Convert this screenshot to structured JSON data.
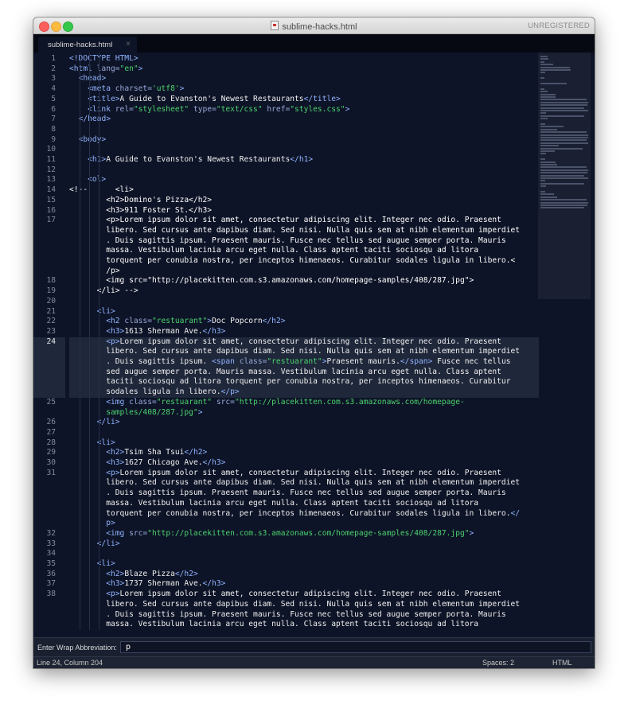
{
  "window": {
    "title": "sublime-hacks.html",
    "unregistered": "UNREGISTERED"
  },
  "tab": {
    "label": "sublime-hacks.html",
    "close": "×"
  },
  "editor": {
    "active_line": 24,
    "visual_lines": [
      {
        "n": "1",
        "tokens": [
          [
            "tag",
            "<!DOCTYPE HTML>"
          ]
        ]
      },
      {
        "n": "2",
        "tokens": [
          [
            "tag",
            "<html "
          ],
          [
            "attr",
            "lang="
          ],
          [
            "str",
            "\"en\""
          ],
          [
            "tag",
            ">"
          ]
        ]
      },
      {
        "n": "3",
        "tokens": [
          [
            "txt",
            "  "
          ],
          [
            "tag",
            "<head>"
          ]
        ]
      },
      {
        "n": "4",
        "tokens": [
          [
            "txt",
            "    "
          ],
          [
            "tag",
            "<meta "
          ],
          [
            "attr",
            "charset="
          ],
          [
            "str",
            "'utf8'"
          ],
          [
            "tag",
            ">"
          ]
        ]
      },
      {
        "n": "5",
        "tokens": [
          [
            "txt",
            "    "
          ],
          [
            "tag",
            "<title>"
          ],
          [
            "txt",
            "A Guide to Evanston's Newest Restaurants"
          ],
          [
            "tag",
            "</title>"
          ]
        ]
      },
      {
        "n": "6",
        "tokens": [
          [
            "txt",
            "    "
          ],
          [
            "tag",
            "<link "
          ],
          [
            "attr",
            "rel="
          ],
          [
            "str",
            "\"stylesheet\""
          ],
          [
            "attr",
            " type="
          ],
          [
            "str",
            "\"text/css\""
          ],
          [
            "attr",
            " href="
          ],
          [
            "str",
            "\"styles.css\""
          ],
          [
            "tag",
            ">"
          ]
        ]
      },
      {
        "n": "7",
        "tokens": [
          [
            "txt",
            "  "
          ],
          [
            "tag",
            "</head>"
          ]
        ]
      },
      {
        "n": "8",
        "tokens": []
      },
      {
        "n": "9",
        "tokens": [
          [
            "txt",
            "  "
          ],
          [
            "tag",
            "<body>"
          ]
        ]
      },
      {
        "n": "10",
        "tokens": []
      },
      {
        "n": "11",
        "tokens": [
          [
            "txt",
            "    "
          ],
          [
            "tag",
            "<h1>"
          ],
          [
            "txt",
            "A Guide to Evanston's Newest Restaurants"
          ],
          [
            "tag",
            "</h1>"
          ]
        ]
      },
      {
        "n": "12",
        "tokens": []
      },
      {
        "n": "13",
        "tokens": [
          [
            "txt",
            "    "
          ],
          [
            "tag",
            "<ol>"
          ]
        ]
      },
      {
        "n": "14",
        "tokens": [
          [
            "cmt",
            "<!--      <li>"
          ]
        ]
      },
      {
        "n": "15",
        "tokens": [
          [
            "cmt",
            "        <h2>Domino's Pizza</h2>"
          ]
        ]
      },
      {
        "n": "16",
        "tokens": [
          [
            "cmt",
            "        <h3>911 Foster St.</h3>"
          ]
        ]
      },
      {
        "n": "17",
        "tokens": [
          [
            "cmt",
            "        <p>Lorem ipsum dolor sit amet, consectetur adipiscing elit. Integer nec odio. Praesent"
          ]
        ]
      },
      {
        "n": "",
        "tokens": [
          [
            "cmt",
            "        libero. Sed cursus ante dapibus diam. Sed nisi. Nulla quis sem at nibh elementum imperdiet"
          ]
        ]
      },
      {
        "n": "",
        "tokens": [
          [
            "cmt",
            "        . Duis sagittis ipsum. Praesent mauris. Fusce nec tellus sed augue semper porta. Mauris"
          ]
        ]
      },
      {
        "n": "",
        "tokens": [
          [
            "cmt",
            "        massa. Vestibulum lacinia arcu eget nulla. Class aptent taciti sociosqu ad litora"
          ]
        ]
      },
      {
        "n": "",
        "tokens": [
          [
            "cmt",
            "        torquent per conubia nostra, per inceptos himenaeos. Curabitur sodales ligula in libero.<"
          ]
        ]
      },
      {
        "n": "",
        "tokens": [
          [
            "cmt",
            "        /p>"
          ]
        ]
      },
      {
        "n": "18",
        "tokens": [
          [
            "cmt",
            "        <img src=\"http://placekitten.com.s3.amazonaws.com/homepage-samples/408/287.jpg\">"
          ]
        ]
      },
      {
        "n": "19",
        "tokens": [
          [
            "cmt",
            "      </li> -->"
          ]
        ]
      },
      {
        "n": "20",
        "tokens": []
      },
      {
        "n": "21",
        "tokens": [
          [
            "txt",
            "      "
          ],
          [
            "tag",
            "<li>"
          ]
        ]
      },
      {
        "n": "22",
        "tokens": [
          [
            "txt",
            "        "
          ],
          [
            "tag",
            "<h2 "
          ],
          [
            "attr",
            "class="
          ],
          [
            "str",
            "\"restuarant\""
          ],
          [
            "tag",
            ">"
          ],
          [
            "txt",
            "Doc Popcorn"
          ],
          [
            "tag",
            "</h2>"
          ]
        ]
      },
      {
        "n": "23",
        "tokens": [
          [
            "txt",
            "        "
          ],
          [
            "tag",
            "<h3>"
          ],
          [
            "txt",
            "1613 Sherman Ave."
          ],
          [
            "tag",
            "</h3>"
          ]
        ]
      },
      {
        "n": "24",
        "tokens": [
          [
            "txt",
            "        "
          ],
          [
            "tag",
            "<p>"
          ],
          [
            "txt",
            "Lorem ipsum dolor sit amet, consectetur adipiscing elit. Integer nec odio. Praesent"
          ]
        ]
      },
      {
        "n": "",
        "tokens": [
          [
            "txt",
            "        libero. Sed cursus ante dapibus diam. Sed nisi. Nulla quis sem at nibh elementum imperdiet"
          ]
        ]
      },
      {
        "n": "",
        "tokens": [
          [
            "txt",
            "        . Duis sagittis ipsum. "
          ],
          [
            "tag",
            "<span "
          ],
          [
            "attr",
            "class="
          ],
          [
            "str",
            "\"restuarant\""
          ],
          [
            "tag",
            ">"
          ],
          [
            "txt",
            "Praesent mauris."
          ],
          [
            "tag",
            "</span>"
          ],
          [
            "txt",
            " Fusce nec tellus"
          ]
        ]
      },
      {
        "n": "",
        "tokens": [
          [
            "txt",
            "        sed augue semper porta. Mauris massa. Vestibulum lacinia arcu eget nulla. Class aptent"
          ]
        ]
      },
      {
        "n": "",
        "tokens": [
          [
            "txt",
            "        taciti sociosqu ad litora torquent per conubia nostra, per inceptos himenaeos. Curabitur"
          ]
        ]
      },
      {
        "n": "",
        "tokens": [
          [
            "txt",
            "        sodales ligula in libero."
          ],
          [
            "tag",
            "</p>"
          ]
        ]
      },
      {
        "n": "25",
        "tokens": [
          [
            "txt",
            "        "
          ],
          [
            "tag",
            "<img "
          ],
          [
            "attr",
            "class="
          ],
          [
            "str",
            "\"restuarant\""
          ],
          [
            "attr",
            " src="
          ],
          [
            "str",
            "\"http://placekitten.com.s3.amazonaws.com/homepage-"
          ]
        ]
      },
      {
        "n": "",
        "tokens": [
          [
            "str",
            "        samples/408/287.jpg\""
          ],
          [
            "tag",
            ">"
          ]
        ]
      },
      {
        "n": "26",
        "tokens": [
          [
            "txt",
            "      "
          ],
          [
            "tag",
            "</li>"
          ]
        ]
      },
      {
        "n": "27",
        "tokens": []
      },
      {
        "n": "28",
        "tokens": [
          [
            "txt",
            "      "
          ],
          [
            "tag",
            "<li>"
          ]
        ]
      },
      {
        "n": "29",
        "tokens": [
          [
            "txt",
            "        "
          ],
          [
            "tag",
            "<h2>"
          ],
          [
            "txt",
            "Tsim Sha Tsui"
          ],
          [
            "tag",
            "</h2>"
          ]
        ]
      },
      {
        "n": "30",
        "tokens": [
          [
            "txt",
            "        "
          ],
          [
            "tag",
            "<h3>"
          ],
          [
            "txt",
            "1627 Chicago Ave."
          ],
          [
            "tag",
            "</h3>"
          ]
        ]
      },
      {
        "n": "31",
        "tokens": [
          [
            "txt",
            "        "
          ],
          [
            "tag",
            "<p>"
          ],
          [
            "txt",
            "Lorem ipsum dolor sit amet, consectetur adipiscing elit. Integer nec odio. Praesent"
          ]
        ]
      },
      {
        "n": "",
        "tokens": [
          [
            "txt",
            "        libero. Sed cursus ante dapibus diam. Sed nisi. Nulla quis sem at nibh elementum imperdiet"
          ]
        ]
      },
      {
        "n": "",
        "tokens": [
          [
            "txt",
            "        . Duis sagittis ipsum. Praesent mauris. Fusce nec tellus sed augue semper porta. Mauris"
          ]
        ]
      },
      {
        "n": "",
        "tokens": [
          [
            "txt",
            "        massa. Vestibulum lacinia arcu eget nulla. Class aptent taciti sociosqu ad litora"
          ]
        ]
      },
      {
        "n": "",
        "tokens": [
          [
            "txt",
            "        torquent per conubia nostra, per inceptos himenaeos. Curabitur sodales ligula in libero."
          ],
          [
            "tag",
            "</"
          ]
        ]
      },
      {
        "n": "",
        "tokens": [
          [
            "tag",
            "        p>"
          ]
        ]
      },
      {
        "n": "32",
        "tokens": [
          [
            "txt",
            "        "
          ],
          [
            "tag",
            "<img "
          ],
          [
            "attr",
            "src="
          ],
          [
            "str",
            "\"http://placekitten.com.s3.amazonaws.com/homepage-samples/408/287.jpg\""
          ],
          [
            "tag",
            ">"
          ]
        ]
      },
      {
        "n": "33",
        "tokens": [
          [
            "txt",
            "      "
          ],
          [
            "tag",
            "</li>"
          ]
        ]
      },
      {
        "n": "34",
        "tokens": []
      },
      {
        "n": "35",
        "tokens": [
          [
            "txt",
            "      "
          ],
          [
            "tag",
            "<li>"
          ]
        ]
      },
      {
        "n": "36",
        "tokens": [
          [
            "txt",
            "        "
          ],
          [
            "tag",
            "<h2>"
          ],
          [
            "txt",
            "Blaze Pizza"
          ],
          [
            "tag",
            "</h2>"
          ]
        ]
      },
      {
        "n": "37",
        "tokens": [
          [
            "txt",
            "        "
          ],
          [
            "tag",
            "<h3>"
          ],
          [
            "txt",
            "1737 Sherman Ave."
          ],
          [
            "tag",
            "</h3>"
          ]
        ]
      },
      {
        "n": "38",
        "tokens": [
          [
            "txt",
            "        "
          ],
          [
            "tag",
            "<p>"
          ],
          [
            "txt",
            "Lorem ipsum dolor sit amet, consectetur adipiscing elit. Integer nec odio. Praesent"
          ]
        ]
      },
      {
        "n": "",
        "tokens": [
          [
            "txt",
            "        libero. Sed cursus ante dapibus diam. Sed nisi. Nulla quis sem at nibh elementum imperdiet"
          ]
        ]
      },
      {
        "n": "",
        "tokens": [
          [
            "txt",
            "        . Duis sagittis ipsum. Praesent mauris. Fusce nec tellus sed augue semper porta. Mauris"
          ]
        ]
      },
      {
        "n": "",
        "tokens": [
          [
            "txt",
            "        massa. Vestibulum lacinia arcu eget nulla. Class aptent taciti sociosqu ad litora"
          ]
        ]
      }
    ]
  },
  "wrap_bar": {
    "label": "Enter Wrap Abbreviation:",
    "value": "p"
  },
  "status": {
    "position": "Line 24, Column 204",
    "spaces": "Spaces: 2",
    "syntax": "HTML"
  },
  "colors": {
    "tag": "#8fb3ff",
    "attribute": "#96a8d8",
    "string": "#4ad16d",
    "text": "#f0f0f0",
    "background": "#0e1427"
  }
}
